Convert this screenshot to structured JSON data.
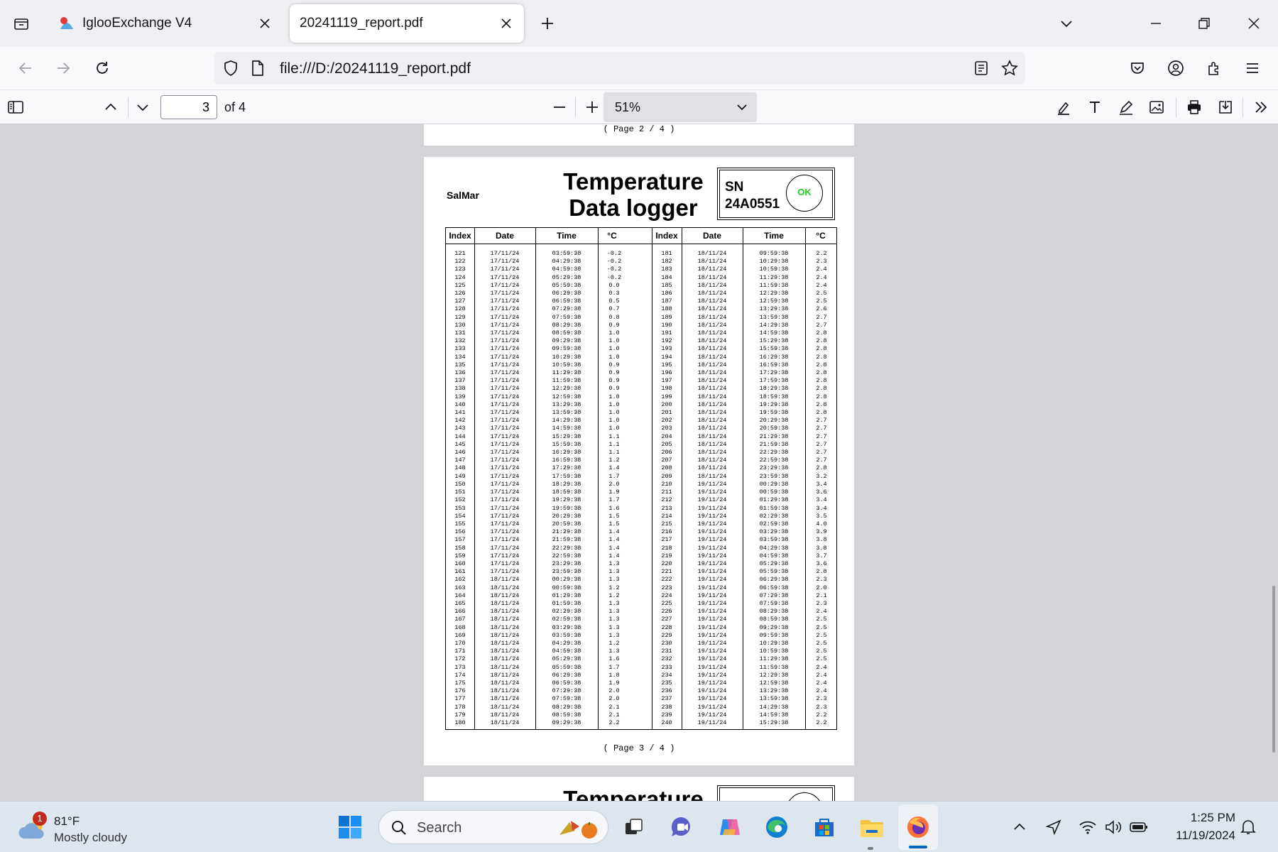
{
  "browser": {
    "tabs": [
      {
        "title": "IglooExchange V4"
      },
      {
        "title": "20241119_report.pdf"
      }
    ],
    "url": "file:///D:/20241119_report.pdf"
  },
  "pdf_toolbar": {
    "current_page": "3",
    "of_pages": "of 4",
    "zoom": "51%"
  },
  "document": {
    "prev_footer": "( Page   2 / 4 )",
    "company": "SalMar",
    "title_line1": "Temperature",
    "title_line2": "Data logger",
    "sn_label": "SN",
    "sn_value": "24A0551",
    "status": "OK",
    "footer": "( Page   3 / 4 )",
    "headers": [
      "Index",
      "Date",
      "Time",
      "°C",
      "Index",
      "Date",
      "Time",
      "°C"
    ],
    "left_rows": [
      [
        "121",
        "17/11/24",
        "03:59:38",
        "-0.2"
      ],
      [
        "122",
        "17/11/24",
        "04:29:38",
        "-0.2"
      ],
      [
        "123",
        "17/11/24",
        "04:59:38",
        "-0.2"
      ],
      [
        "124",
        "17/11/24",
        "05:29:38",
        "-0.2"
      ],
      [
        "125",
        "17/11/24",
        "05:59:38",
        "0.0"
      ],
      [
        "126",
        "17/11/24",
        "06:29:38",
        "0.3"
      ],
      [
        "127",
        "17/11/24",
        "06:59:38",
        "0.5"
      ],
      [
        "128",
        "17/11/24",
        "07:29:38",
        "0.7"
      ],
      [
        "129",
        "17/11/24",
        "07:59:38",
        "0.8"
      ],
      [
        "130",
        "17/11/24",
        "08:29:38",
        "0.9"
      ],
      [
        "131",
        "17/11/24",
        "08:59:38",
        "1.0"
      ],
      [
        "132",
        "17/11/24",
        "09:29:38",
        "1.0"
      ],
      [
        "133",
        "17/11/24",
        "09:59:38",
        "1.0"
      ],
      [
        "134",
        "17/11/24",
        "10:29:38",
        "1.0"
      ],
      [
        "135",
        "17/11/24",
        "10:59:38",
        "0.9"
      ],
      [
        "136",
        "17/11/24",
        "11:29:38",
        "0.9"
      ],
      [
        "137",
        "17/11/24",
        "11:59:38",
        "0.9"
      ],
      [
        "138",
        "17/11/24",
        "12:29:38",
        "0.9"
      ],
      [
        "139",
        "17/11/24",
        "12:59:38",
        "1.0"
      ],
      [
        "140",
        "17/11/24",
        "13:29:38",
        "1.0"
      ],
      [
        "141",
        "17/11/24",
        "13:59:38",
        "1.0"
      ],
      [
        "142",
        "17/11/24",
        "14:29:38",
        "1.0"
      ],
      [
        "143",
        "17/11/24",
        "14:59:38",
        "1.0"
      ],
      [
        "144",
        "17/11/24",
        "15:29:38",
        "1.1"
      ],
      [
        "145",
        "17/11/24",
        "15:59:38",
        "1.1"
      ],
      [
        "146",
        "17/11/24",
        "16:29:38",
        "1.1"
      ],
      [
        "147",
        "17/11/24",
        "16:59:38",
        "1.2"
      ],
      [
        "148",
        "17/11/24",
        "17:29:38",
        "1.4"
      ],
      [
        "149",
        "17/11/24",
        "17:59:38",
        "1.7"
      ],
      [
        "150",
        "17/11/24",
        "18:29:38",
        "2.0"
      ],
      [
        "151",
        "17/11/24",
        "18:59:38",
        "1.9"
      ],
      [
        "152",
        "17/11/24",
        "19:29:38",
        "1.7"
      ],
      [
        "153",
        "17/11/24",
        "19:59:38",
        "1.6"
      ],
      [
        "154",
        "17/11/24",
        "20:29:38",
        "1.5"
      ],
      [
        "155",
        "17/11/24",
        "20:59:38",
        "1.5"
      ],
      [
        "156",
        "17/11/24",
        "21:29:38",
        "1.4"
      ],
      [
        "157",
        "17/11/24",
        "21:59:38",
        "1.4"
      ],
      [
        "158",
        "17/11/24",
        "22:29:38",
        "1.4"
      ],
      [
        "159",
        "17/11/24",
        "22:59:38",
        "1.4"
      ],
      [
        "160",
        "17/11/24",
        "23:29:38",
        "1.3"
      ],
      [
        "161",
        "17/11/24",
        "23:59:38",
        "1.3"
      ],
      [
        "162",
        "18/11/24",
        "00:29:38",
        "1.3"
      ],
      [
        "163",
        "18/11/24",
        "00:59:38",
        "1.2"
      ],
      [
        "164",
        "18/11/24",
        "01:29:38",
        "1.2"
      ],
      [
        "165",
        "18/11/24",
        "01:59:38",
        "1.3"
      ],
      [
        "166",
        "18/11/24",
        "02:29:38",
        "1.3"
      ],
      [
        "167",
        "18/11/24",
        "02:59:38",
        "1.3"
      ],
      [
        "168",
        "18/11/24",
        "03:29:38",
        "1.3"
      ],
      [
        "169",
        "18/11/24",
        "03:59:38",
        "1.3"
      ],
      [
        "170",
        "18/11/24",
        "04:29:38",
        "1.2"
      ],
      [
        "171",
        "18/11/24",
        "04:59:38",
        "1.3"
      ],
      [
        "172",
        "18/11/24",
        "05:29:38",
        "1.6"
      ],
      [
        "173",
        "18/11/24",
        "05:59:38",
        "1.7"
      ],
      [
        "174",
        "18/11/24",
        "06:29:38",
        "1.8"
      ],
      [
        "175",
        "18/11/24",
        "06:59:38",
        "1.9"
      ],
      [
        "176",
        "18/11/24",
        "07:29:38",
        "2.0"
      ],
      [
        "177",
        "18/11/24",
        "07:59:38",
        "2.0"
      ],
      [
        "178",
        "18/11/24",
        "08:29:38",
        "2.1"
      ],
      [
        "179",
        "18/11/24",
        "08:59:38",
        "2.1"
      ],
      [
        "180",
        "18/11/24",
        "09:29:38",
        "2.2"
      ]
    ],
    "right_rows": [
      [
        "181",
        "18/11/24",
        "09:59:38",
        "2.2"
      ],
      [
        "182",
        "18/11/24",
        "10:29:38",
        "2.3"
      ],
      [
        "183",
        "18/11/24",
        "10:59:38",
        "2.4"
      ],
      [
        "184",
        "18/11/24",
        "11:29:38",
        "2.4"
      ],
      [
        "185",
        "18/11/24",
        "11:59:38",
        "2.4"
      ],
      [
        "186",
        "18/11/24",
        "12:29:38",
        "2.5"
      ],
      [
        "187",
        "18/11/24",
        "12:59:38",
        "2.5"
      ],
      [
        "188",
        "18/11/24",
        "13:29:38",
        "2.6"
      ],
      [
        "189",
        "18/11/24",
        "13:59:38",
        "2.7"
      ],
      [
        "190",
        "18/11/24",
        "14:29:38",
        "2.7"
      ],
      [
        "191",
        "18/11/24",
        "14:59:38",
        "2.8"
      ],
      [
        "192",
        "18/11/24",
        "15:29:38",
        "2.8"
      ],
      [
        "193",
        "18/11/24",
        "15:59:38",
        "2.8"
      ],
      [
        "194",
        "18/11/24",
        "16:29:38",
        "2.8"
      ],
      [
        "195",
        "18/11/24",
        "16:59:38",
        "2.8"
      ],
      [
        "196",
        "18/11/24",
        "17:29:38",
        "2.8"
      ],
      [
        "197",
        "18/11/24",
        "17:59:38",
        "2.8"
      ],
      [
        "198",
        "18/11/24",
        "18:29:38",
        "2.8"
      ],
      [
        "199",
        "18/11/24",
        "18:59:38",
        "2.8"
      ],
      [
        "200",
        "18/11/24",
        "19:29:38",
        "2.8"
      ],
      [
        "201",
        "18/11/24",
        "19:59:38",
        "2.8"
      ],
      [
        "202",
        "18/11/24",
        "20:29:38",
        "2.7"
      ],
      [
        "203",
        "18/11/24",
        "20:59:38",
        "2.7"
      ],
      [
        "204",
        "18/11/24",
        "21:29:38",
        "2.7"
      ],
      [
        "205",
        "18/11/24",
        "21:59:38",
        "2.7"
      ],
      [
        "206",
        "18/11/24",
        "22:29:38",
        "2.7"
      ],
      [
        "207",
        "18/11/24",
        "22:59:38",
        "2.7"
      ],
      [
        "208",
        "18/11/24",
        "23:29:38",
        "2.8"
      ],
      [
        "209",
        "18/11/24",
        "23:59:38",
        "3.2"
      ],
      [
        "210",
        "19/11/24",
        "00:29:38",
        "3.4"
      ],
      [
        "211",
        "19/11/24",
        "00:59:38",
        "3.6"
      ],
      [
        "212",
        "19/11/24",
        "01:29:38",
        "3.4"
      ],
      [
        "213",
        "19/11/24",
        "01:59:38",
        "3.4"
      ],
      [
        "214",
        "19/11/24",
        "02:29:38",
        "3.5"
      ],
      [
        "215",
        "19/11/24",
        "02:59:38",
        "4.0"
      ],
      [
        "216",
        "19/11/24",
        "03:29:38",
        "3.9"
      ],
      [
        "217",
        "19/11/24",
        "03:59:38",
        "3.8"
      ],
      [
        "218",
        "19/11/24",
        "04:29:38",
        "3.8"
      ],
      [
        "219",
        "19/11/24",
        "04:59:38",
        "3.7"
      ],
      [
        "220",
        "19/11/24",
        "05:29:38",
        "3.6"
      ],
      [
        "221",
        "19/11/24",
        "05:59:38",
        "2.8"
      ],
      [
        "222",
        "19/11/24",
        "06:29:38",
        "2.3"
      ],
      [
        "223",
        "19/11/24",
        "06:59:38",
        "2.0"
      ],
      [
        "224",
        "19/11/24",
        "07:29:38",
        "2.1"
      ],
      [
        "225",
        "19/11/24",
        "07:59:38",
        "2.3"
      ],
      [
        "226",
        "19/11/24",
        "08:29:38",
        "2.4"
      ],
      [
        "227",
        "19/11/24",
        "08:59:38",
        "2.5"
      ],
      [
        "228",
        "19/11/24",
        "09:29:38",
        "2.5"
      ],
      [
        "229",
        "19/11/24",
        "09:59:38",
        "2.5"
      ],
      [
        "230",
        "19/11/24",
        "10:29:38",
        "2.5"
      ],
      [
        "231",
        "19/11/24",
        "10:59:38",
        "2.5"
      ],
      [
        "232",
        "19/11/24",
        "11:29:38",
        "2.5"
      ],
      [
        "233",
        "19/11/24",
        "11:59:38",
        "2.4"
      ],
      [
        "234",
        "19/11/24",
        "12:29:38",
        "2.4"
      ],
      [
        "235",
        "19/11/24",
        "12:59:38",
        "2.4"
      ],
      [
        "236",
        "19/11/24",
        "13:29:38",
        "2.4"
      ],
      [
        "237",
        "19/11/24",
        "13:59:38",
        "2.3"
      ],
      [
        "238",
        "19/11/24",
        "14:29:38",
        "2.3"
      ],
      [
        "239",
        "19/11/24",
        "14:59:38",
        "2.2"
      ],
      [
        "240",
        "19/11/24",
        "15:29:38",
        "2.2"
      ]
    ],
    "next_title_partial": "Temperature"
  },
  "taskbar": {
    "weather_badge": "1",
    "temperature": "81°F",
    "condition": "Mostly cloudy",
    "search_placeholder": "Search",
    "time": "1:25 PM",
    "date": "11/19/2024"
  }
}
